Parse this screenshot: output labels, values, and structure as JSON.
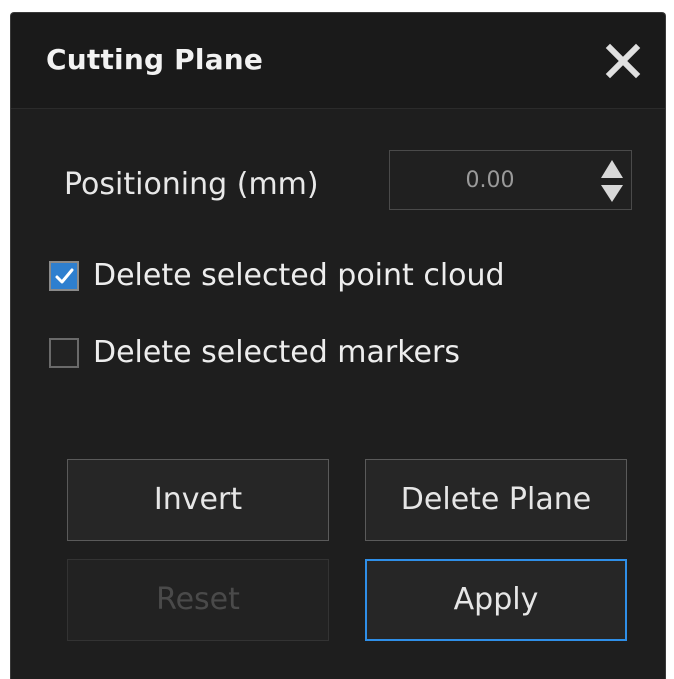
{
  "dialog": {
    "title": "Cutting Plane",
    "close_icon": "close-icon"
  },
  "positioning": {
    "label": "Positioning (mm)",
    "value": "0.00"
  },
  "options": [
    {
      "label": "Delete selected point cloud",
      "checked": true
    },
    {
      "label": "Delete selected markers",
      "checked": false
    }
  ],
  "buttons": {
    "invert": "Invert",
    "delete_plane": "Delete Plane",
    "reset": "Reset",
    "apply": "Apply"
  },
  "colors": {
    "accent": "#2f8fe8",
    "panel_bg": "#1e1e1e",
    "checkbox_checked": "#2e7fcf"
  }
}
